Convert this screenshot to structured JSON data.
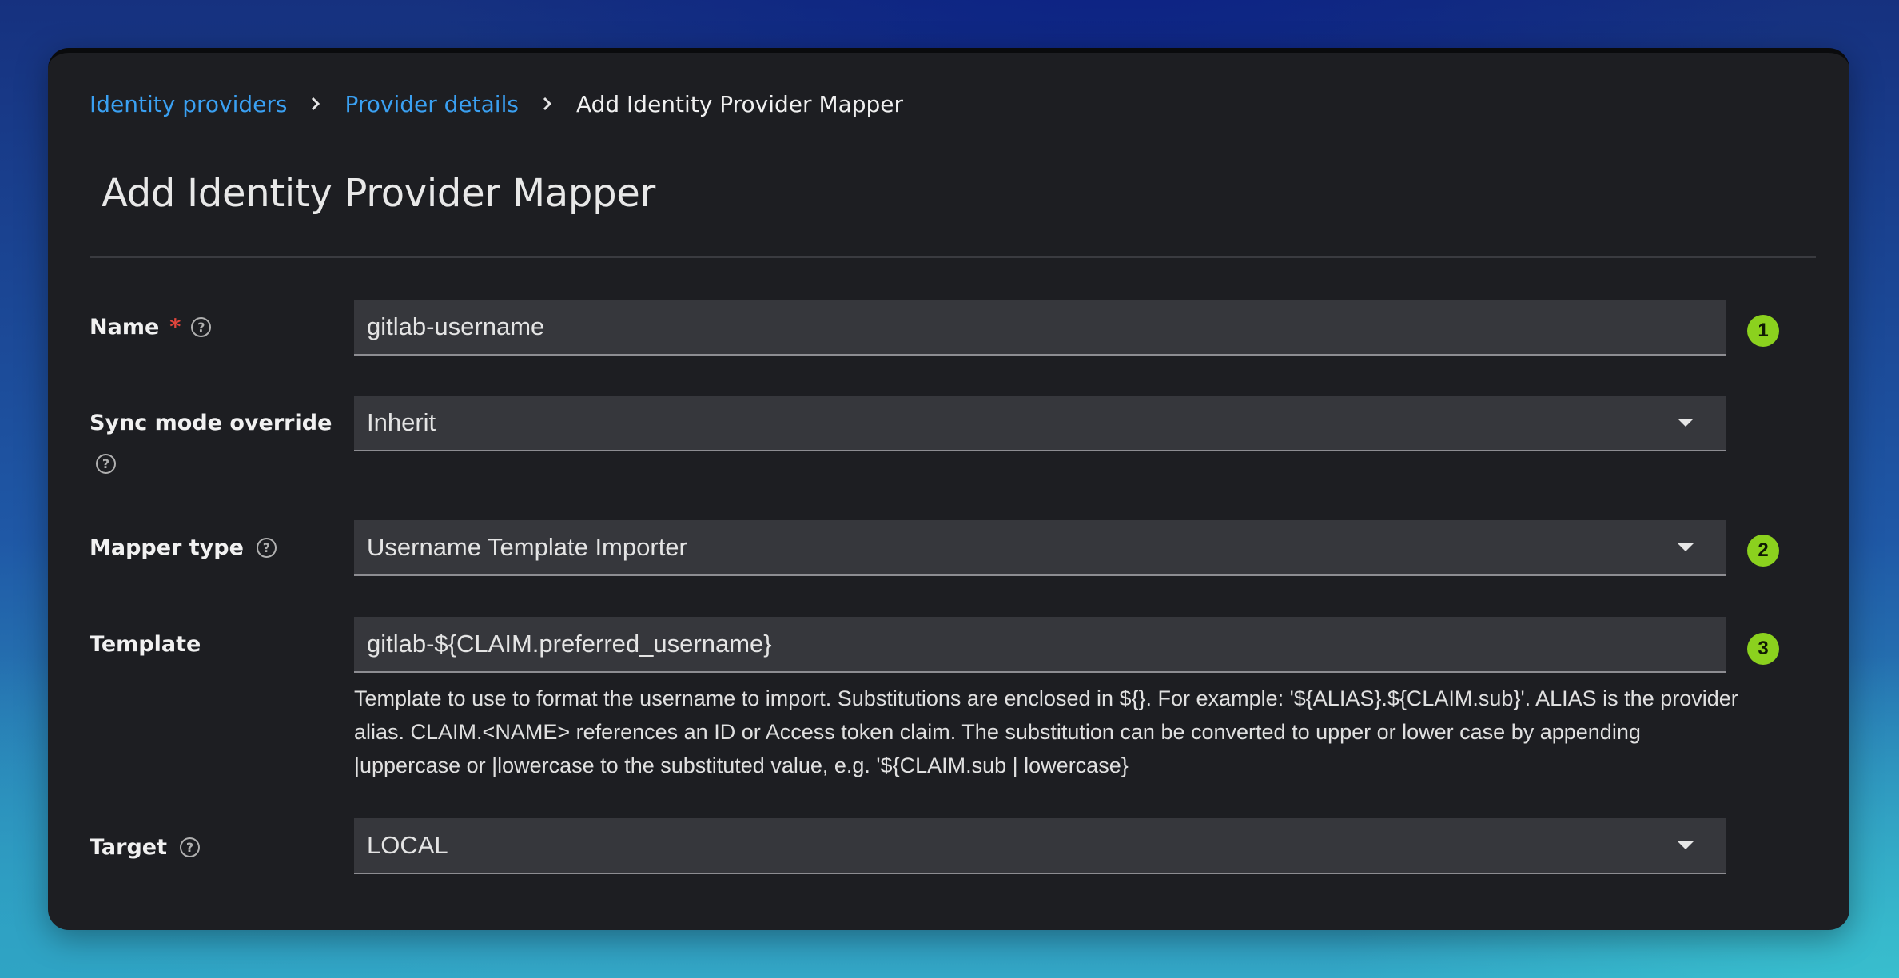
{
  "breadcrumb": {
    "items": [
      "Identity providers",
      "Provider details"
    ],
    "current": "Add Identity Provider Mapper"
  },
  "page": {
    "title": "Add Identity Provider Mapper"
  },
  "form": {
    "name": {
      "label": "Name",
      "required_mark": "*",
      "value": "gitlab-username",
      "badge": "1"
    },
    "sync_mode": {
      "label": "Sync mode override",
      "value": "Inherit"
    },
    "mapper_type": {
      "label": "Mapper type",
      "value": "Username Template Importer",
      "badge": "2"
    },
    "template": {
      "label": "Template",
      "value": "gitlab-${CLAIM.preferred_username}",
      "badge": "3",
      "helper": "Template to use to format the username to import. Substitutions are enclosed in ${}. For example: '${ALIAS}.${CLAIM.sub}'. ALIAS is the provider alias. CLAIM.<NAME> references an ID or Access token claim. The substitution can be converted to upper or lower case by appending |uppercase or |lowercase to the substituted value, e.g. '${CLAIM.sub | lowercase}"
    },
    "target": {
      "label": "Target",
      "value": "LOCAL"
    }
  },
  "icons": {
    "help": "help-circle-icon",
    "caret": "caret-down-icon",
    "separator": "chevron-right-icon"
  },
  "colors": {
    "link": "#3aa0f2",
    "badge": "#8bd11e",
    "required": "#e2453c",
    "card_bg": "#1d1e22",
    "field_bg": "#36373c"
  }
}
